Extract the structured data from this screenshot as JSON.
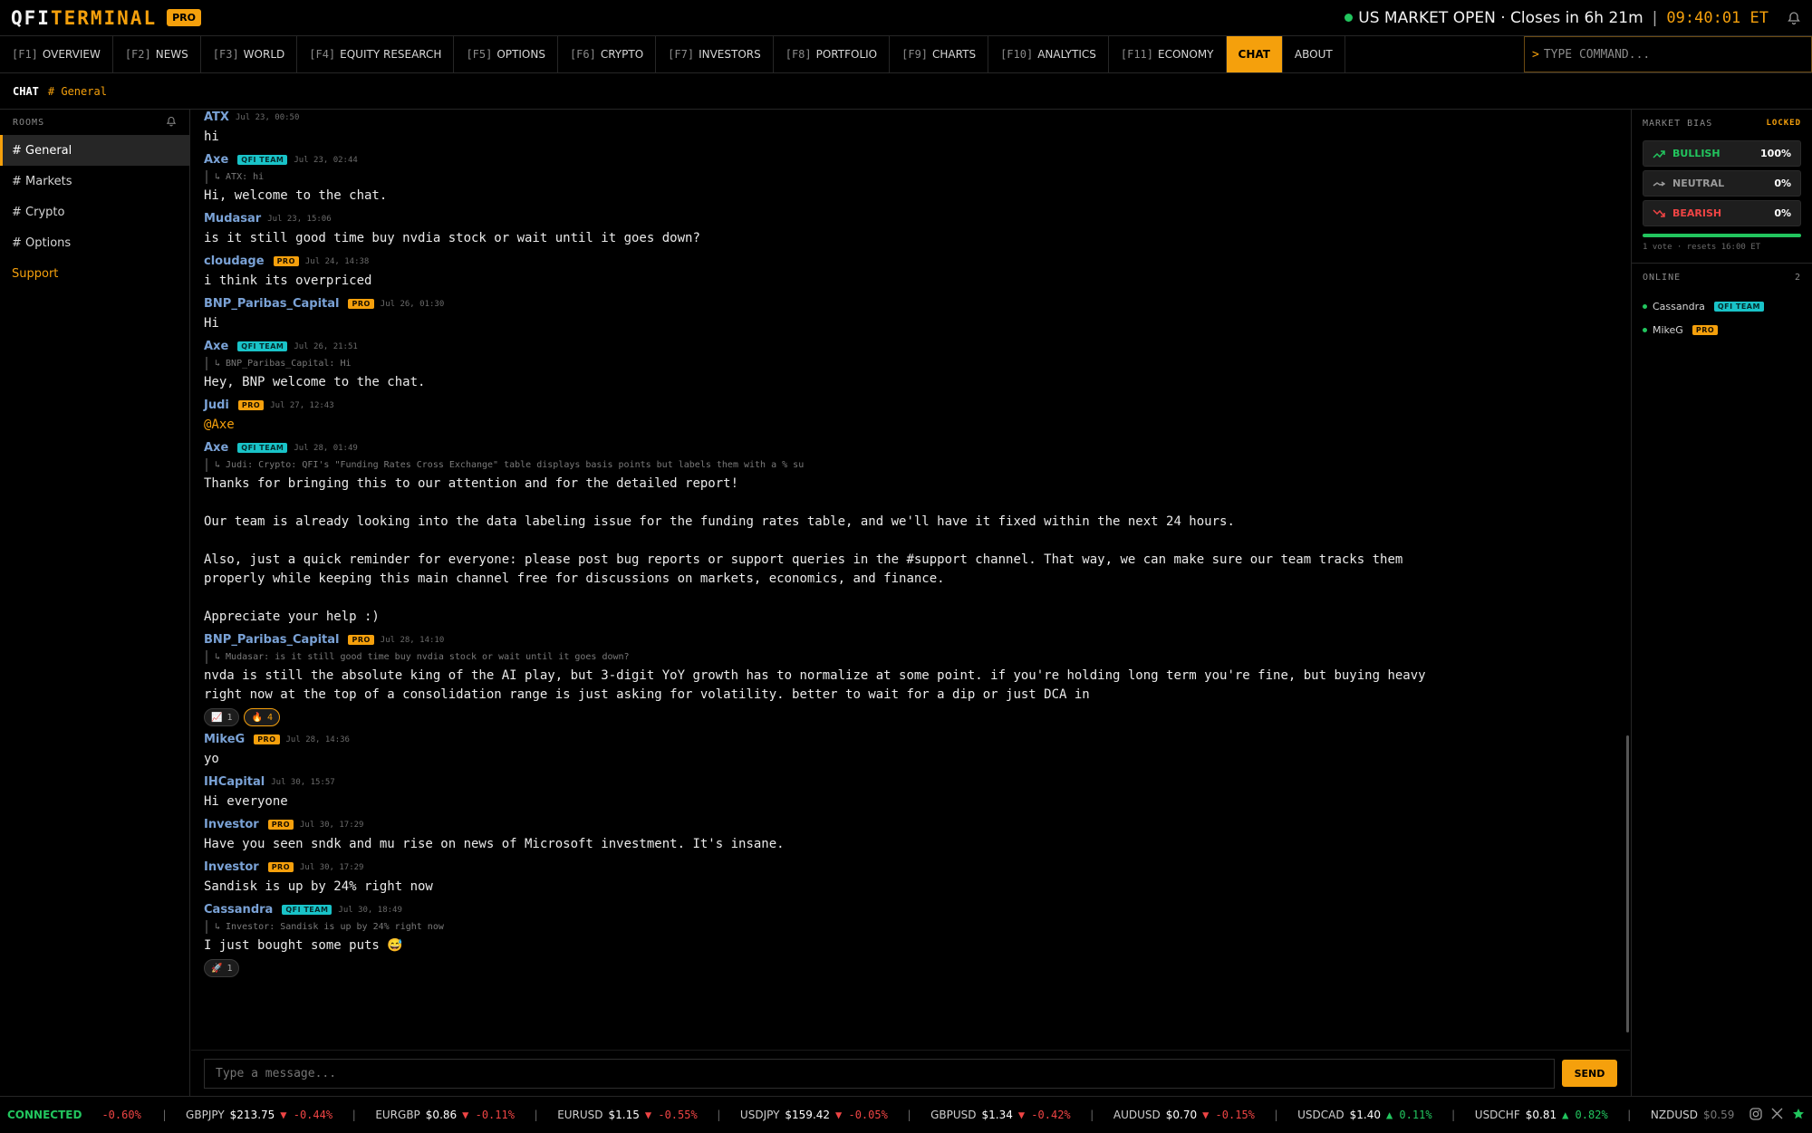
{
  "header": {
    "logo_a": "QFI",
    "logo_b": "TERMINAL",
    "pro": "PRO",
    "market": "US MARKET OPEN · Closes in 6h 21m",
    "sep": "|",
    "clock": "09:40:01 ET"
  },
  "nav": [
    {
      "key": "[F1]",
      "label": "OVERVIEW"
    },
    {
      "key": "[F2]",
      "label": "NEWS"
    },
    {
      "key": "[F3]",
      "label": "WORLD"
    },
    {
      "key": "[F4]",
      "label": "EQUITY RESEARCH"
    },
    {
      "key": "[F5]",
      "label": "OPTIONS"
    },
    {
      "key": "[F6]",
      "label": "CRYPTO"
    },
    {
      "key": "[F7]",
      "label": "INVESTORS"
    },
    {
      "key": "[F8]",
      "label": "PORTFOLIO"
    },
    {
      "key": "[F9]",
      "label": "CHARTS"
    },
    {
      "key": "[F10]",
      "label": "ANALYTICS"
    },
    {
      "key": "[F11]",
      "label": "ECONOMY"
    },
    {
      "key": "",
      "label": "CHAT"
    },
    {
      "key": "",
      "label": "ABOUT"
    }
  ],
  "command": {
    "prompt": ">",
    "placeholder": "TYPE COMMAND..."
  },
  "breadcrumb": {
    "section": "CHAT",
    "room": "# General"
  },
  "rooms": {
    "title": "ROOMS",
    "items": [
      "# General",
      "# Markets",
      "# Crypto",
      "# Options",
      "Support"
    ]
  },
  "messages": [
    {
      "user": "ATX",
      "tag": "",
      "time": "Jul 23, 00:50",
      "reply": "",
      "body": "hi"
    },
    {
      "user": "Axe",
      "tag": "QFI TEAM",
      "time": "Jul 23, 02:44",
      "reply": "↳ ATX: hi",
      "body": "Hi, welcome to the chat."
    },
    {
      "user": "Mudasar",
      "tag": "",
      "time": "Jul 23, 15:06",
      "reply": "",
      "body": "is it still good time buy nvdia stock or wait until it goes down?"
    },
    {
      "user": "cloudage",
      "tag": "PRO",
      "time": "Jul 24, 14:38",
      "reply": "",
      "body": "i think its overpriced"
    },
    {
      "user": "BNP_Paribas_Capital",
      "tag": "PRO",
      "time": "Jul 26, 01:30",
      "reply": "",
      "body": "Hi"
    },
    {
      "user": "Axe",
      "tag": "QFI TEAM",
      "time": "Jul 26, 21:51",
      "reply": "↳ BNP_Paribas_Capital: Hi",
      "body": "Hey, BNP welcome to the chat."
    },
    {
      "user": "Judi",
      "tag": "PRO",
      "time": "Jul 27, 12:43",
      "reply": "",
      "body": "@Axe"
    },
    {
      "user": "Axe",
      "tag": "QFI TEAM",
      "time": "Jul 28, 01:49",
      "reply": "↳ Judi: Crypto: QFI's \"Funding Rates Cross Exchange\" table displays basis points but labels them with a % su",
      "body": "Thanks for bringing this to our attention and for the detailed report!\n\nOur team is already looking into the data labeling issue for the funding rates table, and we'll have it fixed within the next 24 hours.\n\nAlso, just a quick reminder for everyone: please post bug reports or support queries in the #support channel. That way, we can make sure our team tracks them\nproperly while keeping this main channel free for discussions on markets, economics, and finance.\n\nAppreciate your help :)"
    },
    {
      "user": "BNP_Paribas_Capital",
      "tag": "PRO",
      "time": "Jul 28, 14:10",
      "reply": "↳ Mudasar: is it still good time buy nvdia stock or wait until it goes down?",
      "body": "nvda is still the absolute king of the AI play, but 3-digit YoY growth has to normalize at some point. if you're holding long term you're fine, but buying heavy\nright now at the top of a consolidation range is just asking for volatility. better to wait for a dip or just DCA in",
      "reactions": [
        {
          "emoji": "📈",
          "count": "1"
        },
        {
          "emoji": "🔥",
          "count": "4"
        }
      ]
    },
    {
      "user": "MikeG",
      "tag": "PRO",
      "time": "Jul 28, 14:36",
      "reply": "",
      "body": "yo"
    },
    {
      "user": "IHCapital",
      "tag": "",
      "time": "Jul 30, 15:57",
      "reply": "",
      "body": "Hi everyone"
    },
    {
      "user": "Investor",
      "tag": "PRO",
      "time": "Jul 30, 17:29",
      "reply": "",
      "body": "Have you seen sndk and mu rise on news of Microsoft investment. It's insane."
    },
    {
      "user": "Investor",
      "tag": "PRO",
      "time": "Jul 30, 17:29",
      "reply": "",
      "body": "Sandisk is up by 24% right now"
    },
    {
      "user": "Cassandra",
      "tag": "QFI TEAM",
      "time": "Jul 30, 18:49",
      "reply": "↳ Investor: Sandisk is up by 24% right now",
      "body": "I just bought some puts 😅",
      "reactions": [
        {
          "emoji": "🚀",
          "count": "1"
        }
      ]
    }
  ],
  "composer": {
    "placeholder": "Type a message...",
    "send": "SEND"
  },
  "bias": {
    "title": "MARKET BIAS",
    "locked": "LOCKED",
    "bullish_label": "BULLISH",
    "bullish_pct": "100%",
    "neutral_label": "NEUTRAL",
    "neutral_pct": "0%",
    "bearish_label": "BEARISH",
    "bearish_pct": "0%",
    "bullish_share": 1.0,
    "meta": "1 vote · resets 16:00 ET"
  },
  "online": {
    "title": "ONLINE",
    "count": "2",
    "users": [
      {
        "name": "Cassandra",
        "tag": "QFI TEAM"
      },
      {
        "name": "MikeG",
        "tag": "PRO"
      }
    ]
  },
  "footer": {
    "status": "CONNECTED",
    "lead": "-0.60%",
    "tickers": [
      {
        "sym": "GBPJPY",
        "px": "$213.75",
        "chg": "▼ -0.44%",
        "dir": "dn"
      },
      {
        "sym": "EURGBP",
        "px": "$0.86",
        "chg": "▼ -0.11%",
        "dir": "dn"
      },
      {
        "sym": "EURUSD",
        "px": "$1.15",
        "chg": "▼ -0.55%",
        "dir": "dn"
      },
      {
        "sym": "USDJPY",
        "px": "$159.42",
        "chg": "▼ -0.05%",
        "dir": "dn"
      },
      {
        "sym": "GBPUSD",
        "px": "$1.34",
        "chg": "▼ -0.42%",
        "dir": "dn"
      },
      {
        "sym": "AUDUSD",
        "px": "$0.70",
        "chg": "▼ -0.15%",
        "dir": "dn"
      },
      {
        "sym": "USDCAD",
        "px": "$1.40",
        "chg": "▲ 0.11%",
        "dir": "up"
      },
      {
        "sym": "USDCHF",
        "px": "$0.81",
        "chg": "▲ 0.82%",
        "dir": "up"
      },
      {
        "sym": "NZDUSD",
        "px": "$0.59",
        "chg": "",
        "dir": "dn"
      }
    ]
  },
  "colors": {
    "accent": "#f5a00c",
    "up": "#22c55e",
    "down": "#ef4444",
    "team": "#19c3c8"
  }
}
